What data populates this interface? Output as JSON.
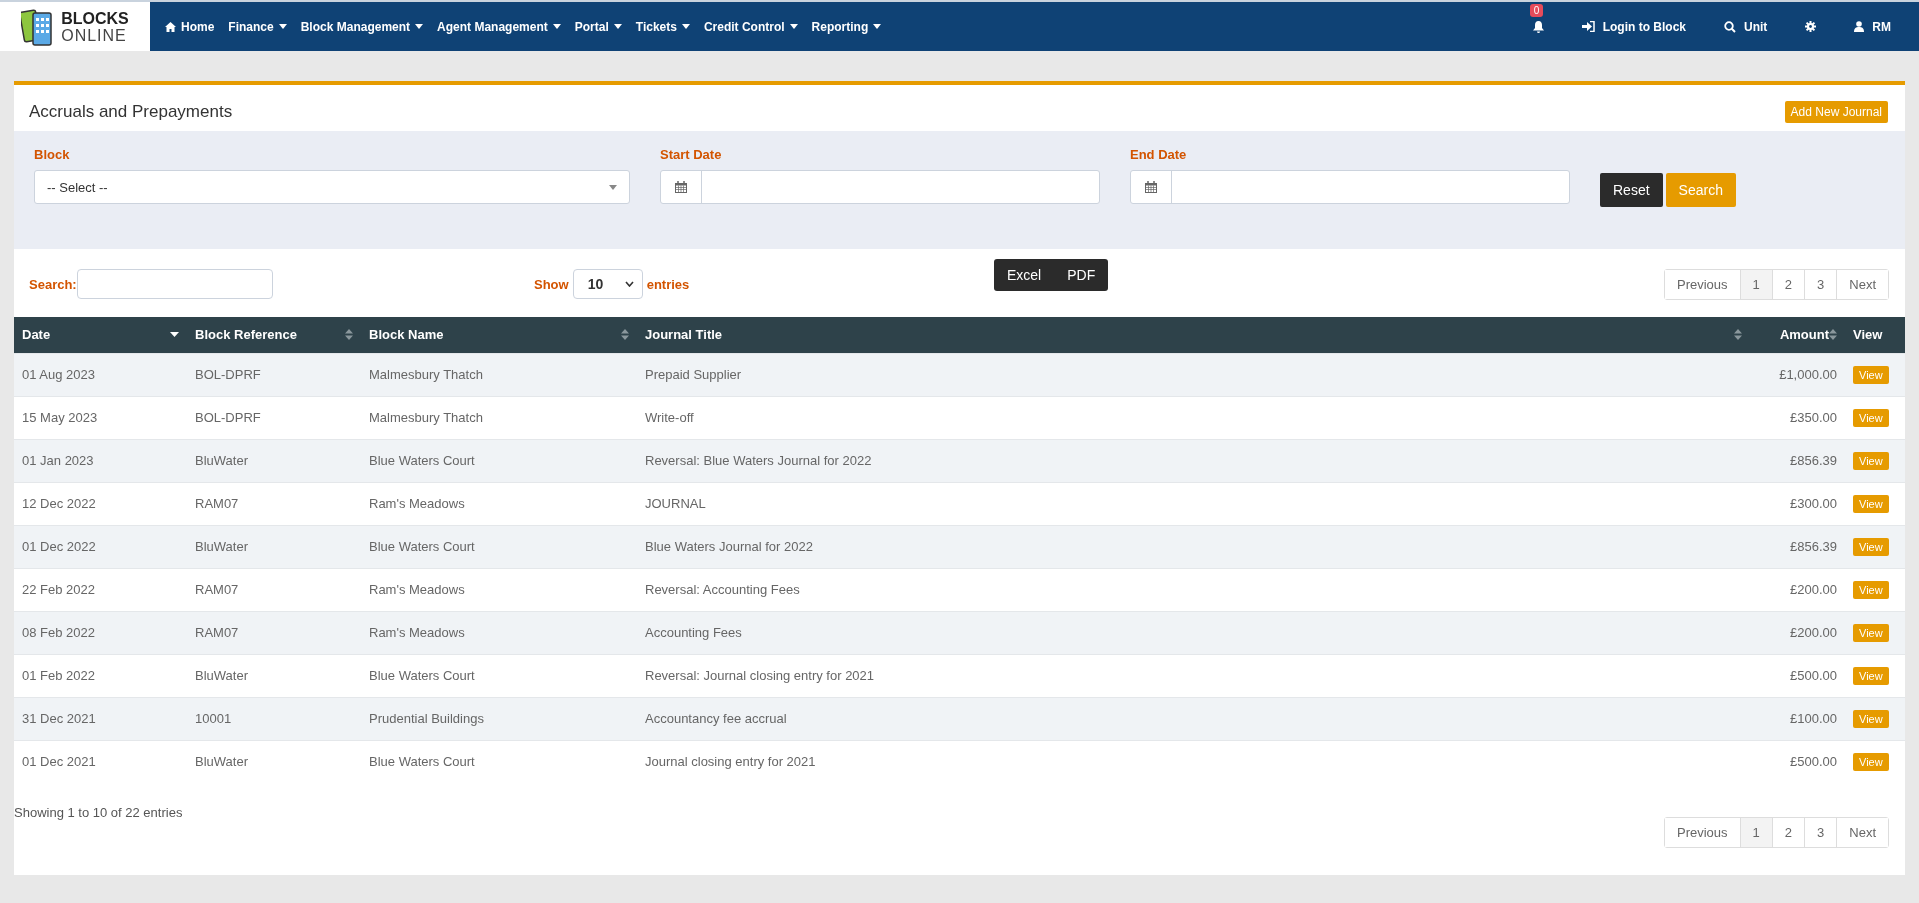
{
  "navbar": {
    "logo": {
      "line1": "BLOCKS",
      "line2": "ONLINE"
    },
    "menu": [
      {
        "label": "Home",
        "kind": "home"
      },
      {
        "label": "Finance",
        "kind": "dropdown"
      },
      {
        "label": "Block Management",
        "kind": "dropdown"
      },
      {
        "label": "Agent Management",
        "kind": "dropdown"
      },
      {
        "label": "Portal",
        "kind": "dropdown"
      },
      {
        "label": "Tickets",
        "kind": "dropdown"
      },
      {
        "label": "Credit Control",
        "kind": "dropdown"
      },
      {
        "label": "Reporting",
        "kind": "dropdown"
      }
    ],
    "right": [
      {
        "kind": "bell",
        "badge": "0"
      },
      {
        "kind": "login",
        "label": "Login to Block"
      },
      {
        "kind": "search",
        "label": "Unit"
      },
      {
        "kind": "settings"
      },
      {
        "kind": "user",
        "label": "RM"
      }
    ]
  },
  "page": {
    "title": "Accruals and Prepayments",
    "add_button": "Add New Journal"
  },
  "filters": {
    "block": {
      "label": "Block",
      "value": "-- Select --"
    },
    "start_date": {
      "label": "Start Date"
    },
    "end_date": {
      "label": "End Date"
    },
    "buttons": [
      {
        "kind": "dark",
        "label": "Reset"
      },
      {
        "kind": "primary",
        "label": "Search"
      }
    ]
  },
  "toolbar": {
    "search_label": "Search:",
    "show_label": "Show",
    "show_value": "10",
    "entries_label": "entries",
    "export_buttons": [
      "Excel",
      "PDF"
    ],
    "pagination": [
      {
        "label": "Previous",
        "selected": false
      },
      {
        "label": "1",
        "selected": true
      },
      {
        "label": "2",
        "selected": false
      },
      {
        "label": "3",
        "selected": false
      },
      {
        "label": "Next",
        "selected": false
      }
    ]
  },
  "table": {
    "columns": [
      {
        "label": "Date",
        "kind": "sorted_desc"
      },
      {
        "label": "Block Reference",
        "kind": "sortable"
      },
      {
        "label": "Block Name",
        "kind": "sortable"
      },
      {
        "label": "Journal Title",
        "kind": "sortable"
      },
      {
        "label": "Amount",
        "kind": "sortable"
      },
      {
        "label": "View",
        "kind": "plain"
      }
    ],
    "rows": [
      {
        "date": "01 Aug 2023",
        "ref": "BOL-DPRF",
        "name": "Malmesbury Thatch",
        "title": "Prepaid Supplier",
        "amount": "£1,000.00",
        "action": "View"
      },
      {
        "date": "15 May 2023",
        "ref": "BOL-DPRF",
        "name": "Malmesbury Thatch",
        "title": "Write-off",
        "amount": "£350.00",
        "action": "View"
      },
      {
        "date": "01 Jan 2023",
        "ref": "BluWater",
        "name": "Blue Waters Court",
        "title": "Reversal: Blue Waters Journal for 2022",
        "amount": "£856.39",
        "action": "View"
      },
      {
        "date": "12 Dec 2022",
        "ref": "RAM07",
        "name": "Ram's Meadows",
        "title": "JOURNAL",
        "amount": "£300.00",
        "action": "View"
      },
      {
        "date": "01 Dec 2022",
        "ref": "BluWater",
        "name": "Blue Waters Court",
        "title": "Blue Waters Journal for 2022",
        "amount": "£856.39",
        "action": "View"
      },
      {
        "date": "22 Feb 2022",
        "ref": "RAM07",
        "name": "Ram's Meadows",
        "title": "Reversal: Accounting Fees",
        "amount": "£200.00",
        "action": "View"
      },
      {
        "date": "08 Feb 2022",
        "ref": "RAM07",
        "name": "Ram's Meadows",
        "title": "Accounting Fees",
        "amount": "£200.00",
        "action": "View"
      },
      {
        "date": "01 Feb 2022",
        "ref": "BluWater",
        "name": "Blue Waters Court",
        "title": "Reversal: Journal closing entry for 2021",
        "amount": "£500.00",
        "action": "View"
      },
      {
        "date": "31 Dec 2021",
        "ref": "10001",
        "name": "Prudential Buildings",
        "title": "Accountancy fee accrual",
        "amount": "£100.00",
        "action": "View"
      },
      {
        "date": "01 Dec 2021",
        "ref": "BluWater",
        "name": "Blue Waters Court",
        "title": "Journal closing entry for 2021",
        "amount": "£500.00",
        "action": "View"
      }
    ]
  },
  "footer": {
    "info": "Showing 1 to 10 of 22 entries",
    "pagination": [
      {
        "label": "Previous",
        "selected": false
      },
      {
        "label": "1",
        "selected": true
      },
      {
        "label": "2",
        "selected": false
      },
      {
        "label": "3",
        "selected": false
      },
      {
        "label": "Next",
        "selected": false
      }
    ]
  }
}
